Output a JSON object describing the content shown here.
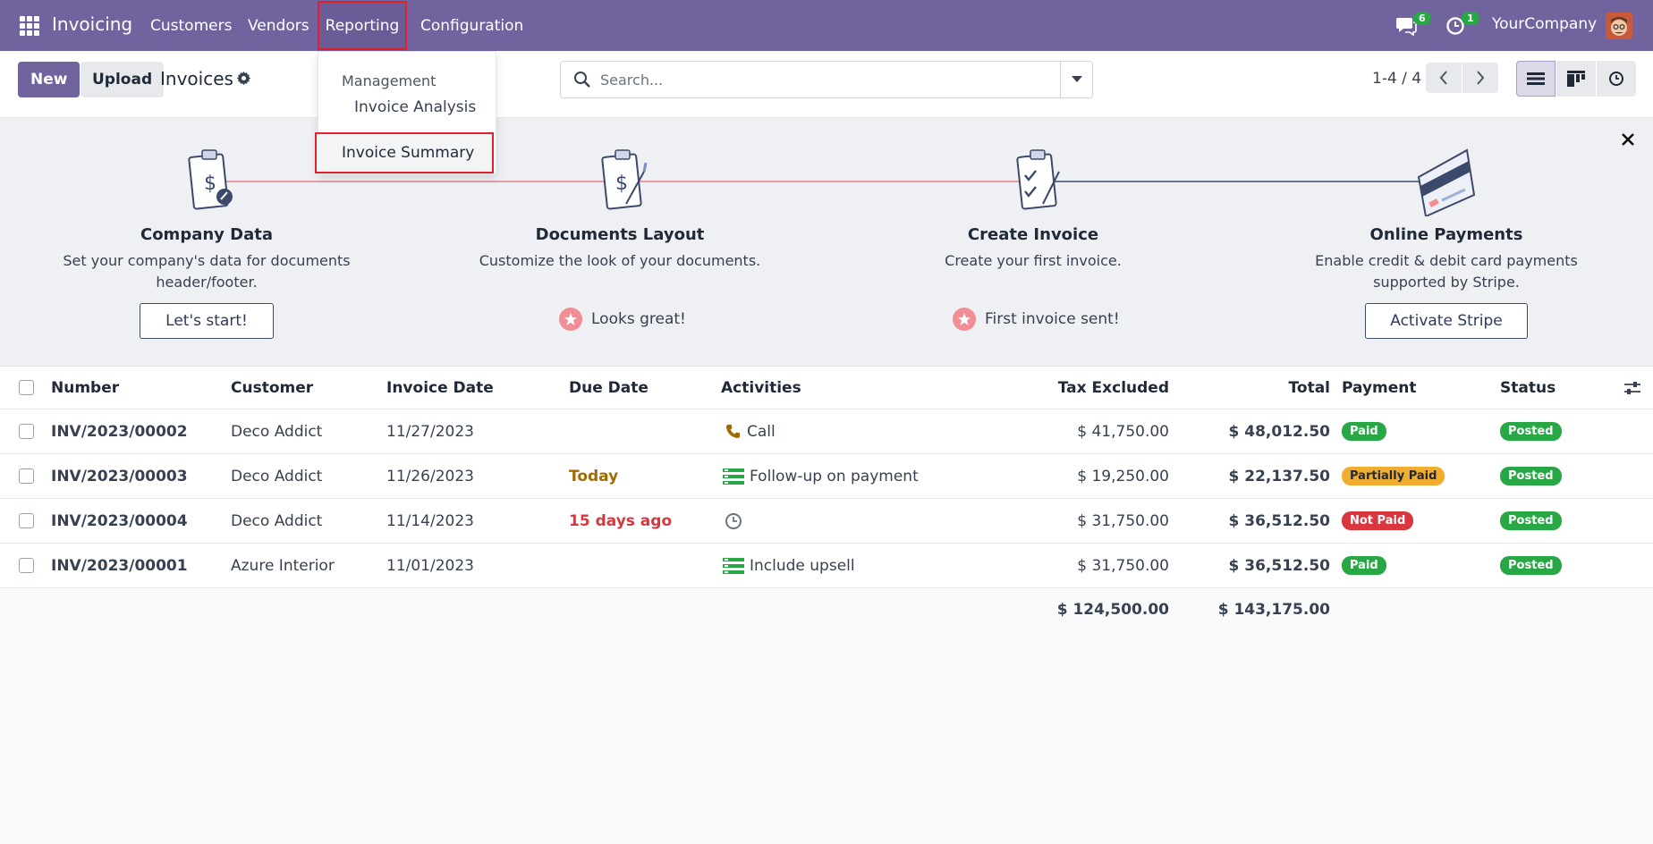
{
  "navbar": {
    "app_title": "Invoicing",
    "menus": [
      "Customers",
      "Vendors",
      "Reporting",
      "Configuration"
    ],
    "messages_count": "6",
    "activities_count": "1",
    "company": "YourCompany"
  },
  "reporting_dropdown": {
    "section": "Management",
    "items": [
      "Invoice Analysis",
      "Invoice Summary"
    ]
  },
  "control": {
    "new_label": "New",
    "upload_label": "Upload",
    "title": "Invoices",
    "search_placeholder": "Search...",
    "pager": "1-4 / 4"
  },
  "onboarding": {
    "steps": [
      {
        "title": "Company Data",
        "desc_line1": "Set your company's data for documents",
        "desc_line2": "header/footer.",
        "button": "Let's start!"
      },
      {
        "title": "Documents Layout",
        "desc_line1": "Customize the look of your documents.",
        "desc_line2": "",
        "done": "Looks great!"
      },
      {
        "title": "Create Invoice",
        "desc_line1": "Create your first invoice.",
        "desc_line2": "",
        "done": "First invoice sent!"
      },
      {
        "title": "Online Payments",
        "desc_line1": "Enable credit & debit card payments",
        "desc_line2": "supported by Stripe.",
        "button": "Activate Stripe"
      }
    ]
  },
  "table": {
    "headers": {
      "number": "Number",
      "customer": "Customer",
      "invoice_date": "Invoice Date",
      "due_date": "Due Date",
      "activities": "Activities",
      "tax_excluded": "Tax Excluded",
      "total": "Total",
      "payment": "Payment",
      "status": "Status"
    },
    "rows": [
      {
        "number": "INV/2023/00002",
        "customer": "Deco Addict",
        "invoice_date": "11/27/2023",
        "due_date": "",
        "activity": "Call",
        "tax_excluded": "$ 41,750.00",
        "total": "$ 48,012.50",
        "payment": "Paid",
        "status": "Posted"
      },
      {
        "number": "INV/2023/00003",
        "customer": "Deco Addict",
        "invoice_date": "11/26/2023",
        "due_date": "Today",
        "activity": "Follow-up on payment",
        "tax_excluded": "$ 19,250.00",
        "total": "$ 22,137.50",
        "payment": "Partially Paid",
        "status": "Posted"
      },
      {
        "number": "INV/2023/00004",
        "customer": "Deco Addict",
        "invoice_date": "11/14/2023",
        "due_date": "15 days ago",
        "activity": "",
        "tax_excluded": "$ 31,750.00",
        "total": "$ 36,512.50",
        "payment": "Not Paid",
        "status": "Posted"
      },
      {
        "number": "INV/2023/00001",
        "customer": "Azure Interior",
        "invoice_date": "11/01/2023",
        "due_date": "",
        "activity": "Include upsell",
        "tax_excluded": "$ 31,750.00",
        "total": "$ 36,512.50",
        "payment": "Paid",
        "status": "Posted"
      }
    ],
    "totals": {
      "tax_excluded": "$ 124,500.00",
      "total": "$ 143,175.00"
    }
  },
  "colors": {
    "brand": "#71639e",
    "highlight": "#e0202a",
    "paid": "#28a745",
    "partial": "#f0ad30",
    "not_paid": "#d9363e",
    "today": "#a06a00",
    "overdue": "#d9363e"
  }
}
